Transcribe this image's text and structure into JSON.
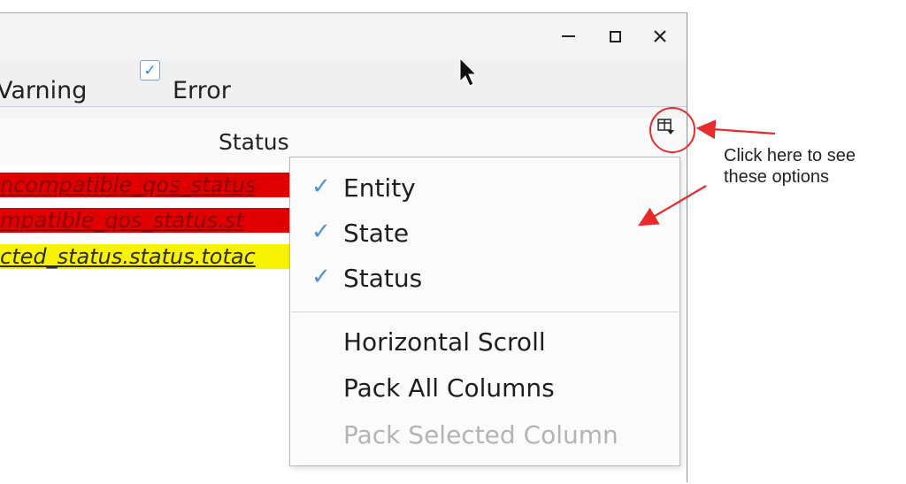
{
  "window": {
    "controls": [
      "—",
      "☐",
      "✕"
    ]
  },
  "filters": {
    "warning_label": "Varning",
    "error_label": "Error",
    "error_checked": "✓"
  },
  "table": {
    "column_title": "Status",
    "rows": [
      {
        "text": "ncompatible_qos_status",
        "color": "red"
      },
      {
        "text": "mpatible_qos_status.st",
        "color": "red"
      },
      {
        "text": "cted_status.status.totac",
        "color": "yellow"
      }
    ]
  },
  "menu": {
    "items": [
      {
        "label": "Entity",
        "checked": "✓"
      },
      {
        "label": "State",
        "checked": "✓"
      },
      {
        "label": "Status",
        "checked": "✓"
      }
    ],
    "actions": [
      {
        "label": "Horizontal Scroll"
      },
      {
        "label": "Pack All Columns"
      },
      {
        "label": "Pack Selected Column"
      }
    ]
  },
  "annotation": {
    "line1": "Click here to see",
    "line2": "these options",
    "color": "#ea2b2b"
  }
}
